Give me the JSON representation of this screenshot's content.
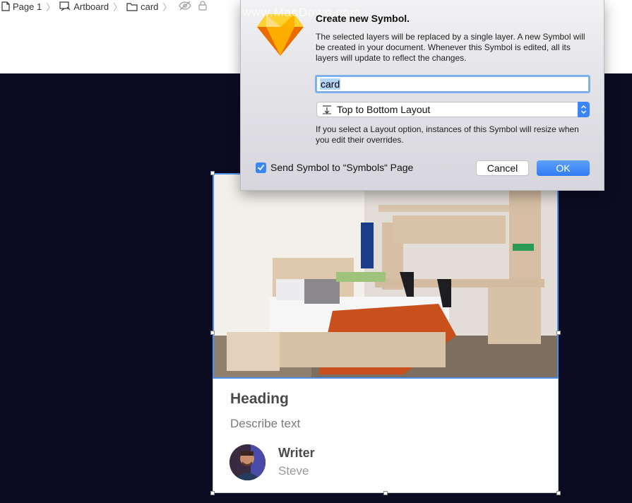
{
  "breadcrumb": {
    "items": [
      {
        "label": "Page 1",
        "icon": "page-icon"
      },
      {
        "label": "Artboard",
        "icon": "artboard-icon"
      },
      {
        "label": "card",
        "icon": "folder-icon"
      }
    ],
    "separator": "〉",
    "extra_icons": [
      "hidden-eye-icon",
      "lock-icon"
    ]
  },
  "dialog": {
    "watermark": "www.MacDown.com",
    "title": "Create new Symbol.",
    "description": "The selected layers will be replaced by a single layer. A new Symbol will be created in your document. Whenever this Symbol is edited, all its layers will update to reflect the changes.",
    "symbol_name_value": "card",
    "layout_option": "Top to Bottom Layout",
    "layout_hint": "If you select a Layout option, instances of this Symbol will resize when you edit their overrides.",
    "send_checkbox_label": "Send Symbol to “Symbols“ Page",
    "send_checked": true,
    "cancel_label": "Cancel",
    "ok_label": "OK"
  },
  "card": {
    "heading": "Heading",
    "description": "Describe text",
    "writer_label": "Writer",
    "writer_name": "Steve"
  },
  "colors": {
    "canvas_bg": "#0b0c22",
    "accent": "#3b86f5",
    "selection": "#4a8ee8"
  }
}
